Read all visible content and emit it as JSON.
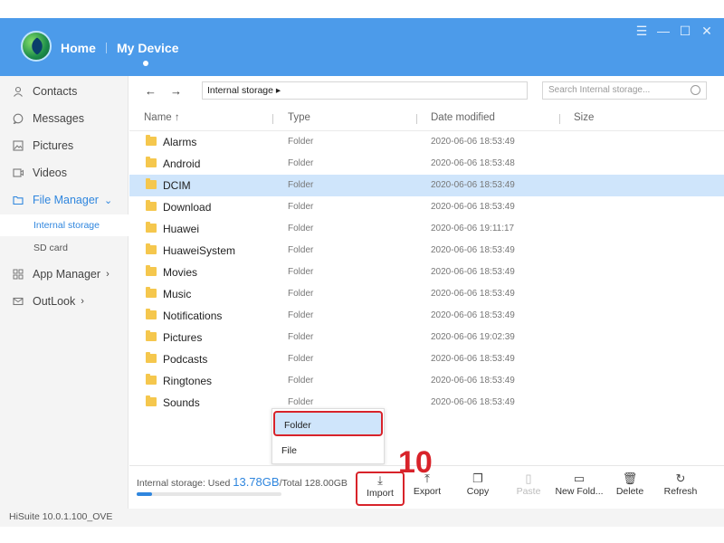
{
  "header": {
    "home": "Home",
    "my_device": "My Device",
    "window_controls": [
      "☰",
      "—",
      "☐",
      "✕"
    ]
  },
  "sidebar": {
    "items": [
      {
        "label": "Contacts",
        "icon": "person-icon"
      },
      {
        "label": "Messages",
        "icon": "chat-icon"
      },
      {
        "label": "Pictures",
        "icon": "picture-icon"
      },
      {
        "label": "Videos",
        "icon": "video-icon"
      },
      {
        "label": "File Manager",
        "icon": "folder-icon",
        "chevron": "⌄"
      },
      {
        "label": "App Manager",
        "icon": "grid-icon",
        "chevron": "›"
      },
      {
        "label": "OutLook",
        "icon": "mail-icon",
        "chevron": "›"
      }
    ],
    "sub_items": [
      "Internal storage",
      "SD card"
    ]
  },
  "toolbar": {
    "back": "←",
    "forward": "→",
    "path": "Internal storage ▸",
    "search_placeholder": "Search Internal storage..."
  },
  "columns": [
    "Name ↑",
    "Type",
    "Date modified",
    "Size"
  ],
  "rows": [
    {
      "name": "Alarms",
      "type": "Folder",
      "date": "2020-06-06 18:53:49"
    },
    {
      "name": "Android",
      "type": "Folder",
      "date": "2020-06-06 18:53:48"
    },
    {
      "name": "DCIM",
      "type": "Folder",
      "date": "2020-06-06 18:53:49"
    },
    {
      "name": "Download",
      "type": "Folder",
      "date": "2020-06-06 18:53:49"
    },
    {
      "name": "Huawei",
      "type": "Folder",
      "date": "2020-06-06 19:11:17"
    },
    {
      "name": "HuaweiSystem",
      "type": "Folder",
      "date": "2020-06-06 18:53:49"
    },
    {
      "name": "Movies",
      "type": "Folder",
      "date": "2020-06-06 18:53:49"
    },
    {
      "name": "Music",
      "type": "Folder",
      "date": "2020-06-06 18:53:49"
    },
    {
      "name": "Notifications",
      "type": "Folder",
      "date": "2020-06-06 18:53:49"
    },
    {
      "name": "Pictures",
      "type": "Folder",
      "date": "2020-06-06 19:02:39"
    },
    {
      "name": "Podcasts",
      "type": "Folder",
      "date": "2020-06-06 18:53:49"
    },
    {
      "name": "Ringtones",
      "type": "Folder",
      "date": "2020-06-06 18:53:49"
    },
    {
      "name": "Sounds",
      "type": "Folder",
      "date": "2020-06-06 18:53:49"
    }
  ],
  "import_menu": {
    "items": [
      "Folder",
      "File"
    ]
  },
  "step_number": "10",
  "storage": {
    "prefix": "Internal storage: Used ",
    "used": "13.78GB",
    "total": "/Total 128.00GB",
    "used_fraction": 0.108
  },
  "actions": [
    {
      "label": "Import",
      "icon": "import-icon",
      "glyph": "⤓"
    },
    {
      "label": "Export",
      "icon": "export-icon",
      "glyph": "⤒"
    },
    {
      "label": "Copy",
      "icon": "copy-icon",
      "glyph": "❐"
    },
    {
      "label": "Paste",
      "icon": "paste-icon",
      "glyph": "▯"
    },
    {
      "label": "New Fold...",
      "icon": "new-folder-icon",
      "glyph": "▭"
    },
    {
      "label": "Delete",
      "icon": "trash-icon",
      "glyph": "🗑"
    },
    {
      "label": "Refresh",
      "icon": "refresh-icon",
      "glyph": "↻"
    }
  ],
  "footer": "HiSuite 10.0.1.100_OVE",
  "colors": {
    "header": "#4c9bea",
    "accent": "#2f86de",
    "selection": "#cfe5fb",
    "highlight_red": "#d8232a",
    "folder": "#f5c74d"
  }
}
